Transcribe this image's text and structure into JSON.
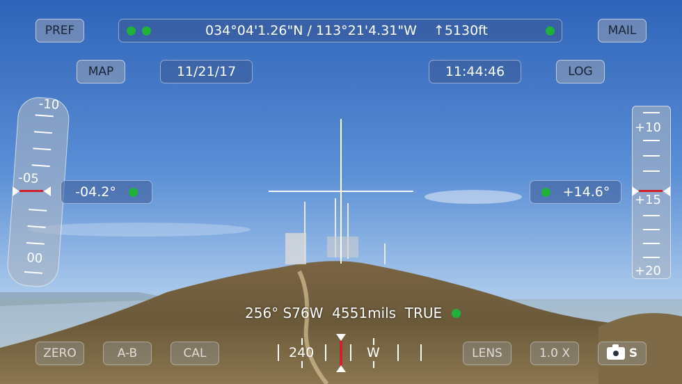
{
  "top": {
    "pref_label": "PREF",
    "mail_label": "MAIL",
    "map_label": "MAP",
    "log_label": "LOG",
    "coords": "034°04'1.26\"N / 113°21'4.31\"W",
    "elevation": "↑5130ft",
    "date": "11/21/17",
    "time": "11:44:46"
  },
  "left_inclinometer": {
    "ticks": [
      "-10",
      "-05",
      "00"
    ],
    "readout": "-04.2°"
  },
  "right_inclinometer": {
    "ticks": [
      "+10",
      "+15",
      "+20"
    ],
    "readout": "+14.6°"
  },
  "heading": {
    "text": "256° S76W  4551mils  TRUE",
    "compass_labels": [
      "240",
      "W"
    ]
  },
  "bottom": {
    "zero_label": "ZERO",
    "ab_label": "A-B",
    "cal_label": "CAL",
    "lens_label": "LENS",
    "zoom_label": "1.0 X",
    "camera_label": "S"
  },
  "colors": {
    "status_green": "#1fb13a",
    "marker_red": "#d0202a"
  }
}
